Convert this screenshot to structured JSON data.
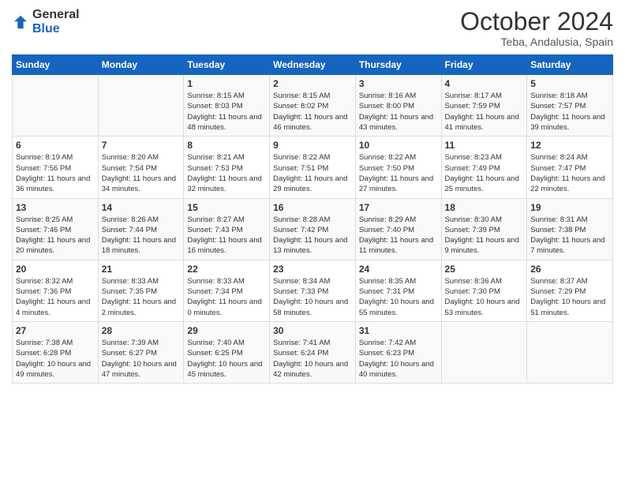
{
  "logo": {
    "general": "General",
    "blue": "Blue"
  },
  "header": {
    "title": "October 2024",
    "subtitle": "Teba, Andalusia, Spain"
  },
  "days_of_week": [
    "Sunday",
    "Monday",
    "Tuesday",
    "Wednesday",
    "Thursday",
    "Friday",
    "Saturday"
  ],
  "weeks": [
    [
      {
        "day": "",
        "info": ""
      },
      {
        "day": "",
        "info": ""
      },
      {
        "day": "1",
        "info": "Sunrise: 8:15 AM\nSunset: 8:03 PM\nDaylight: 11 hours and 48 minutes."
      },
      {
        "day": "2",
        "info": "Sunrise: 8:15 AM\nSunset: 8:02 PM\nDaylight: 11 hours and 46 minutes."
      },
      {
        "day": "3",
        "info": "Sunrise: 8:16 AM\nSunset: 8:00 PM\nDaylight: 11 hours and 43 minutes."
      },
      {
        "day": "4",
        "info": "Sunrise: 8:17 AM\nSunset: 7:59 PM\nDaylight: 11 hours and 41 minutes."
      },
      {
        "day": "5",
        "info": "Sunrise: 8:18 AM\nSunset: 7:57 PM\nDaylight: 11 hours and 39 minutes."
      }
    ],
    [
      {
        "day": "6",
        "info": "Sunrise: 8:19 AM\nSunset: 7:56 PM\nDaylight: 11 hours and 36 minutes."
      },
      {
        "day": "7",
        "info": "Sunrise: 8:20 AM\nSunset: 7:54 PM\nDaylight: 11 hours and 34 minutes."
      },
      {
        "day": "8",
        "info": "Sunrise: 8:21 AM\nSunset: 7:53 PM\nDaylight: 11 hours and 32 minutes."
      },
      {
        "day": "9",
        "info": "Sunrise: 8:22 AM\nSunset: 7:51 PM\nDaylight: 11 hours and 29 minutes."
      },
      {
        "day": "10",
        "info": "Sunrise: 8:22 AM\nSunset: 7:50 PM\nDaylight: 11 hours and 27 minutes."
      },
      {
        "day": "11",
        "info": "Sunrise: 8:23 AM\nSunset: 7:49 PM\nDaylight: 11 hours and 25 minutes."
      },
      {
        "day": "12",
        "info": "Sunrise: 8:24 AM\nSunset: 7:47 PM\nDaylight: 11 hours and 22 minutes."
      }
    ],
    [
      {
        "day": "13",
        "info": "Sunrise: 8:25 AM\nSunset: 7:46 PM\nDaylight: 11 hours and 20 minutes."
      },
      {
        "day": "14",
        "info": "Sunrise: 8:26 AM\nSunset: 7:44 PM\nDaylight: 11 hours and 18 minutes."
      },
      {
        "day": "15",
        "info": "Sunrise: 8:27 AM\nSunset: 7:43 PM\nDaylight: 11 hours and 16 minutes."
      },
      {
        "day": "16",
        "info": "Sunrise: 8:28 AM\nSunset: 7:42 PM\nDaylight: 11 hours and 13 minutes."
      },
      {
        "day": "17",
        "info": "Sunrise: 8:29 AM\nSunset: 7:40 PM\nDaylight: 11 hours and 11 minutes."
      },
      {
        "day": "18",
        "info": "Sunrise: 8:30 AM\nSunset: 7:39 PM\nDaylight: 11 hours and 9 minutes."
      },
      {
        "day": "19",
        "info": "Sunrise: 8:31 AM\nSunset: 7:38 PM\nDaylight: 11 hours and 7 minutes."
      }
    ],
    [
      {
        "day": "20",
        "info": "Sunrise: 8:32 AM\nSunset: 7:36 PM\nDaylight: 11 hours and 4 minutes."
      },
      {
        "day": "21",
        "info": "Sunrise: 8:33 AM\nSunset: 7:35 PM\nDaylight: 11 hours and 2 minutes."
      },
      {
        "day": "22",
        "info": "Sunrise: 8:33 AM\nSunset: 7:34 PM\nDaylight: 11 hours and 0 minutes."
      },
      {
        "day": "23",
        "info": "Sunrise: 8:34 AM\nSunset: 7:33 PM\nDaylight: 10 hours and 58 minutes."
      },
      {
        "day": "24",
        "info": "Sunrise: 8:35 AM\nSunset: 7:31 PM\nDaylight: 10 hours and 55 minutes."
      },
      {
        "day": "25",
        "info": "Sunrise: 8:36 AM\nSunset: 7:30 PM\nDaylight: 10 hours and 53 minutes."
      },
      {
        "day": "26",
        "info": "Sunrise: 8:37 AM\nSunset: 7:29 PM\nDaylight: 10 hours and 51 minutes."
      }
    ],
    [
      {
        "day": "27",
        "info": "Sunrise: 7:38 AM\nSunset: 6:28 PM\nDaylight: 10 hours and 49 minutes."
      },
      {
        "day": "28",
        "info": "Sunrise: 7:39 AM\nSunset: 6:27 PM\nDaylight: 10 hours and 47 minutes."
      },
      {
        "day": "29",
        "info": "Sunrise: 7:40 AM\nSunset: 6:25 PM\nDaylight: 10 hours and 45 minutes."
      },
      {
        "day": "30",
        "info": "Sunrise: 7:41 AM\nSunset: 6:24 PM\nDaylight: 10 hours and 42 minutes."
      },
      {
        "day": "31",
        "info": "Sunrise: 7:42 AM\nSunset: 6:23 PM\nDaylight: 10 hours and 40 minutes."
      },
      {
        "day": "",
        "info": ""
      },
      {
        "day": "",
        "info": ""
      }
    ]
  ]
}
